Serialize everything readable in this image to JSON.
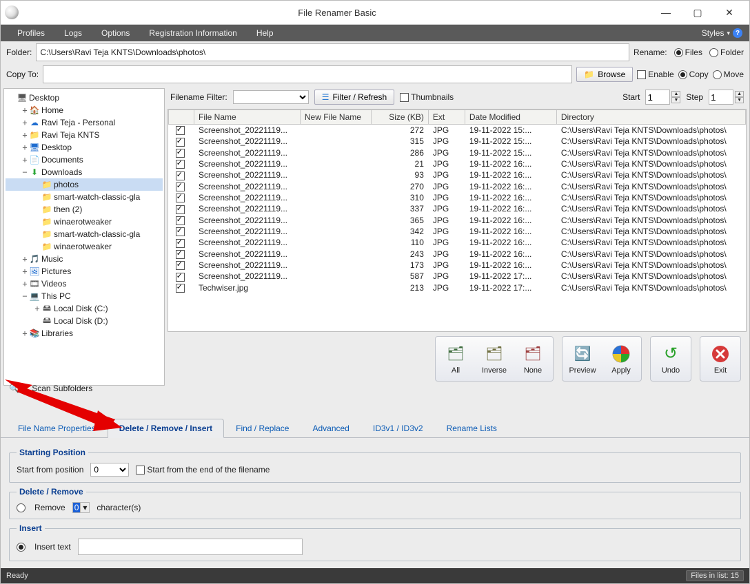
{
  "title": "File Renamer Basic",
  "menus": {
    "profiles": "Profiles",
    "logs": "Logs",
    "options": "Options",
    "reg": "Registration Information",
    "help": "Help",
    "styles": "Styles"
  },
  "folder": {
    "label": "Folder:",
    "path": "C:\\Users\\Ravi Teja KNTS\\Downloads\\photos\\",
    "rename_label": "Rename:",
    "opt_files": "Files",
    "opt_folder": "Folder"
  },
  "copy": {
    "label": "Copy To:",
    "browse": "Browse",
    "enable": "Enable",
    "copy": "Copy",
    "move": "Move"
  },
  "filter": {
    "label": "Filename Filter:",
    "refresh": "Filter / Refresh",
    "thumbs": "Thumbnails",
    "start_label": "Start",
    "start_val": "1",
    "step_label": "Step",
    "step_val": "1"
  },
  "grid": {
    "headers": {
      "chk": "",
      "file": "File Name",
      "new": "New File Name",
      "size": "Size (KB)",
      "ext": "Ext",
      "date": "Date Modified",
      "dir": "Directory"
    },
    "rows": [
      {
        "file": "Screenshot_20221119...",
        "size": "272",
        "ext": "JPG",
        "date": "19-11-2022 15:...",
        "dir": "C:\\Users\\Ravi Teja KNTS\\Downloads\\photos\\"
      },
      {
        "file": "Screenshot_20221119...",
        "size": "315",
        "ext": "JPG",
        "date": "19-11-2022 15:...",
        "dir": "C:\\Users\\Ravi Teja KNTS\\Downloads\\photos\\"
      },
      {
        "file": "Screenshot_20221119...",
        "size": "286",
        "ext": "JPG",
        "date": "19-11-2022 15:...",
        "dir": "C:\\Users\\Ravi Teja KNTS\\Downloads\\photos\\"
      },
      {
        "file": "Screenshot_20221119...",
        "size": "21",
        "ext": "JPG",
        "date": "19-11-2022 16:...",
        "dir": "C:\\Users\\Ravi Teja KNTS\\Downloads\\photos\\"
      },
      {
        "file": "Screenshot_20221119...",
        "size": "93",
        "ext": "JPG",
        "date": "19-11-2022 16:...",
        "dir": "C:\\Users\\Ravi Teja KNTS\\Downloads\\photos\\"
      },
      {
        "file": "Screenshot_20221119...",
        "size": "270",
        "ext": "JPG",
        "date": "19-11-2022 16:...",
        "dir": "C:\\Users\\Ravi Teja KNTS\\Downloads\\photos\\"
      },
      {
        "file": "Screenshot_20221119...",
        "size": "310",
        "ext": "JPG",
        "date": "19-11-2022 16:...",
        "dir": "C:\\Users\\Ravi Teja KNTS\\Downloads\\photos\\"
      },
      {
        "file": "Screenshot_20221119...",
        "size": "337",
        "ext": "JPG",
        "date": "19-11-2022 16:...",
        "dir": "C:\\Users\\Ravi Teja KNTS\\Downloads\\photos\\"
      },
      {
        "file": "Screenshot_20221119...",
        "size": "365",
        "ext": "JPG",
        "date": "19-11-2022 16:...",
        "dir": "C:\\Users\\Ravi Teja KNTS\\Downloads\\photos\\"
      },
      {
        "file": "Screenshot_20221119...",
        "size": "342",
        "ext": "JPG",
        "date": "19-11-2022 16:...",
        "dir": "C:\\Users\\Ravi Teja KNTS\\Downloads\\photos\\"
      },
      {
        "file": "Screenshot_20221119...",
        "size": "110",
        "ext": "JPG",
        "date": "19-11-2022 16:...",
        "dir": "C:\\Users\\Ravi Teja KNTS\\Downloads\\photos\\"
      },
      {
        "file": "Screenshot_20221119...",
        "size": "243",
        "ext": "JPG",
        "date": "19-11-2022 16:...",
        "dir": "C:\\Users\\Ravi Teja KNTS\\Downloads\\photos\\"
      },
      {
        "file": "Screenshot_20221119...",
        "size": "173",
        "ext": "JPG",
        "date": "19-11-2022 16:...",
        "dir": "C:\\Users\\Ravi Teja KNTS\\Downloads\\photos\\"
      },
      {
        "file": "Screenshot_20221119...",
        "size": "587",
        "ext": "JPG",
        "date": "19-11-2022 17:...",
        "dir": "C:\\Users\\Ravi Teja KNTS\\Downloads\\photos\\"
      },
      {
        "file": "Techwiser.jpg",
        "size": "213",
        "ext": "JPG",
        "date": "19-11-2022 17:...",
        "dir": "C:\\Users\\Ravi Teja KNTS\\Downloads\\photos\\"
      }
    ]
  },
  "tree": [
    {
      "depth": 0,
      "exp": "",
      "icon": "🖥",
      "label": "Desktop"
    },
    {
      "depth": 1,
      "exp": "+",
      "icon": "🏠",
      "label": "Home",
      "iconColor": "#d08b2a"
    },
    {
      "depth": 1,
      "exp": "+",
      "icon": "☁",
      "label": "Ravi Teja - Personal",
      "iconColor": "#1f6dd0"
    },
    {
      "depth": 1,
      "exp": "+",
      "icon": "📁",
      "label": "Ravi Teja KNTS",
      "iconColor": "#d9a441"
    },
    {
      "depth": 1,
      "exp": "+",
      "icon": "🖥",
      "label": "Desktop",
      "iconColor": "#1f6dd0"
    },
    {
      "depth": 1,
      "exp": "+",
      "icon": "📄",
      "label": "Documents",
      "iconColor": "#555"
    },
    {
      "depth": 1,
      "exp": "−",
      "icon": "⬇",
      "label": "Downloads",
      "iconColor": "#2fa83a"
    },
    {
      "depth": 2,
      "exp": "",
      "icon": "📁",
      "label": "photos",
      "sel": true,
      "iconColor": "#d9a441"
    },
    {
      "depth": 2,
      "exp": "",
      "icon": "📁",
      "label": "smart-watch-classic-gla",
      "iconColor": "#d9a441"
    },
    {
      "depth": 2,
      "exp": "",
      "icon": "📁",
      "label": "then (2)",
      "iconColor": "#d9a441"
    },
    {
      "depth": 2,
      "exp": "",
      "icon": "📁",
      "label": "winaerotweaker",
      "iconColor": "#d9a441"
    },
    {
      "depth": 2,
      "exp": "",
      "icon": "📁",
      "label": "smart-watch-classic-gla",
      "iconColor": "#d9a441"
    },
    {
      "depth": 2,
      "exp": "",
      "icon": "📁",
      "label": "winaerotweaker",
      "iconColor": "#d9a441"
    },
    {
      "depth": 1,
      "exp": "+",
      "icon": "🎵",
      "label": "Music",
      "iconColor": "#c04848"
    },
    {
      "depth": 1,
      "exp": "+",
      "icon": "🖼",
      "label": "Pictures",
      "iconColor": "#1f6dd0"
    },
    {
      "depth": 1,
      "exp": "+",
      "icon": "🎞",
      "label": "Videos",
      "iconColor": "#444"
    },
    {
      "depth": 1,
      "exp": "−",
      "icon": "💻",
      "label": "This PC",
      "iconColor": "#1f6dd0"
    },
    {
      "depth": 2,
      "exp": "+",
      "icon": "🖴",
      "label": "Local Disk (C:)"
    },
    {
      "depth": 2,
      "exp": "",
      "icon": "🖴",
      "label": "Local Disk (D:)"
    },
    {
      "depth": 1,
      "exp": "+",
      "icon": "📚",
      "label": "Libraries",
      "iconColor": "#d9a441"
    }
  ],
  "scan": "Scan Subfolders",
  "bigbtns": {
    "all": "All",
    "inverse": "Inverse",
    "none": "None",
    "preview": "Preview",
    "apply": "Apply",
    "undo": "Undo",
    "exit": "Exit"
  },
  "tabs": {
    "fnp": "File Name Properties",
    "del": "Delete / Remove / Insert",
    "find": "Find / Replace",
    "adv": "Advanced",
    "id3": "ID3v1 / ID3v2",
    "ren": "Rename Lists"
  },
  "starting": {
    "legend": "Starting Position",
    "label": "Start from position",
    "value": "0",
    "chk": "Start from the end of the filename"
  },
  "delete": {
    "legend": "Delete / Remove",
    "remove": "Remove",
    "value": "0",
    "chars": "character(s)"
  },
  "insert": {
    "legend": "Insert",
    "label": "Insert text"
  },
  "status": {
    "ready": "Ready",
    "files": "Files in list: 15"
  }
}
